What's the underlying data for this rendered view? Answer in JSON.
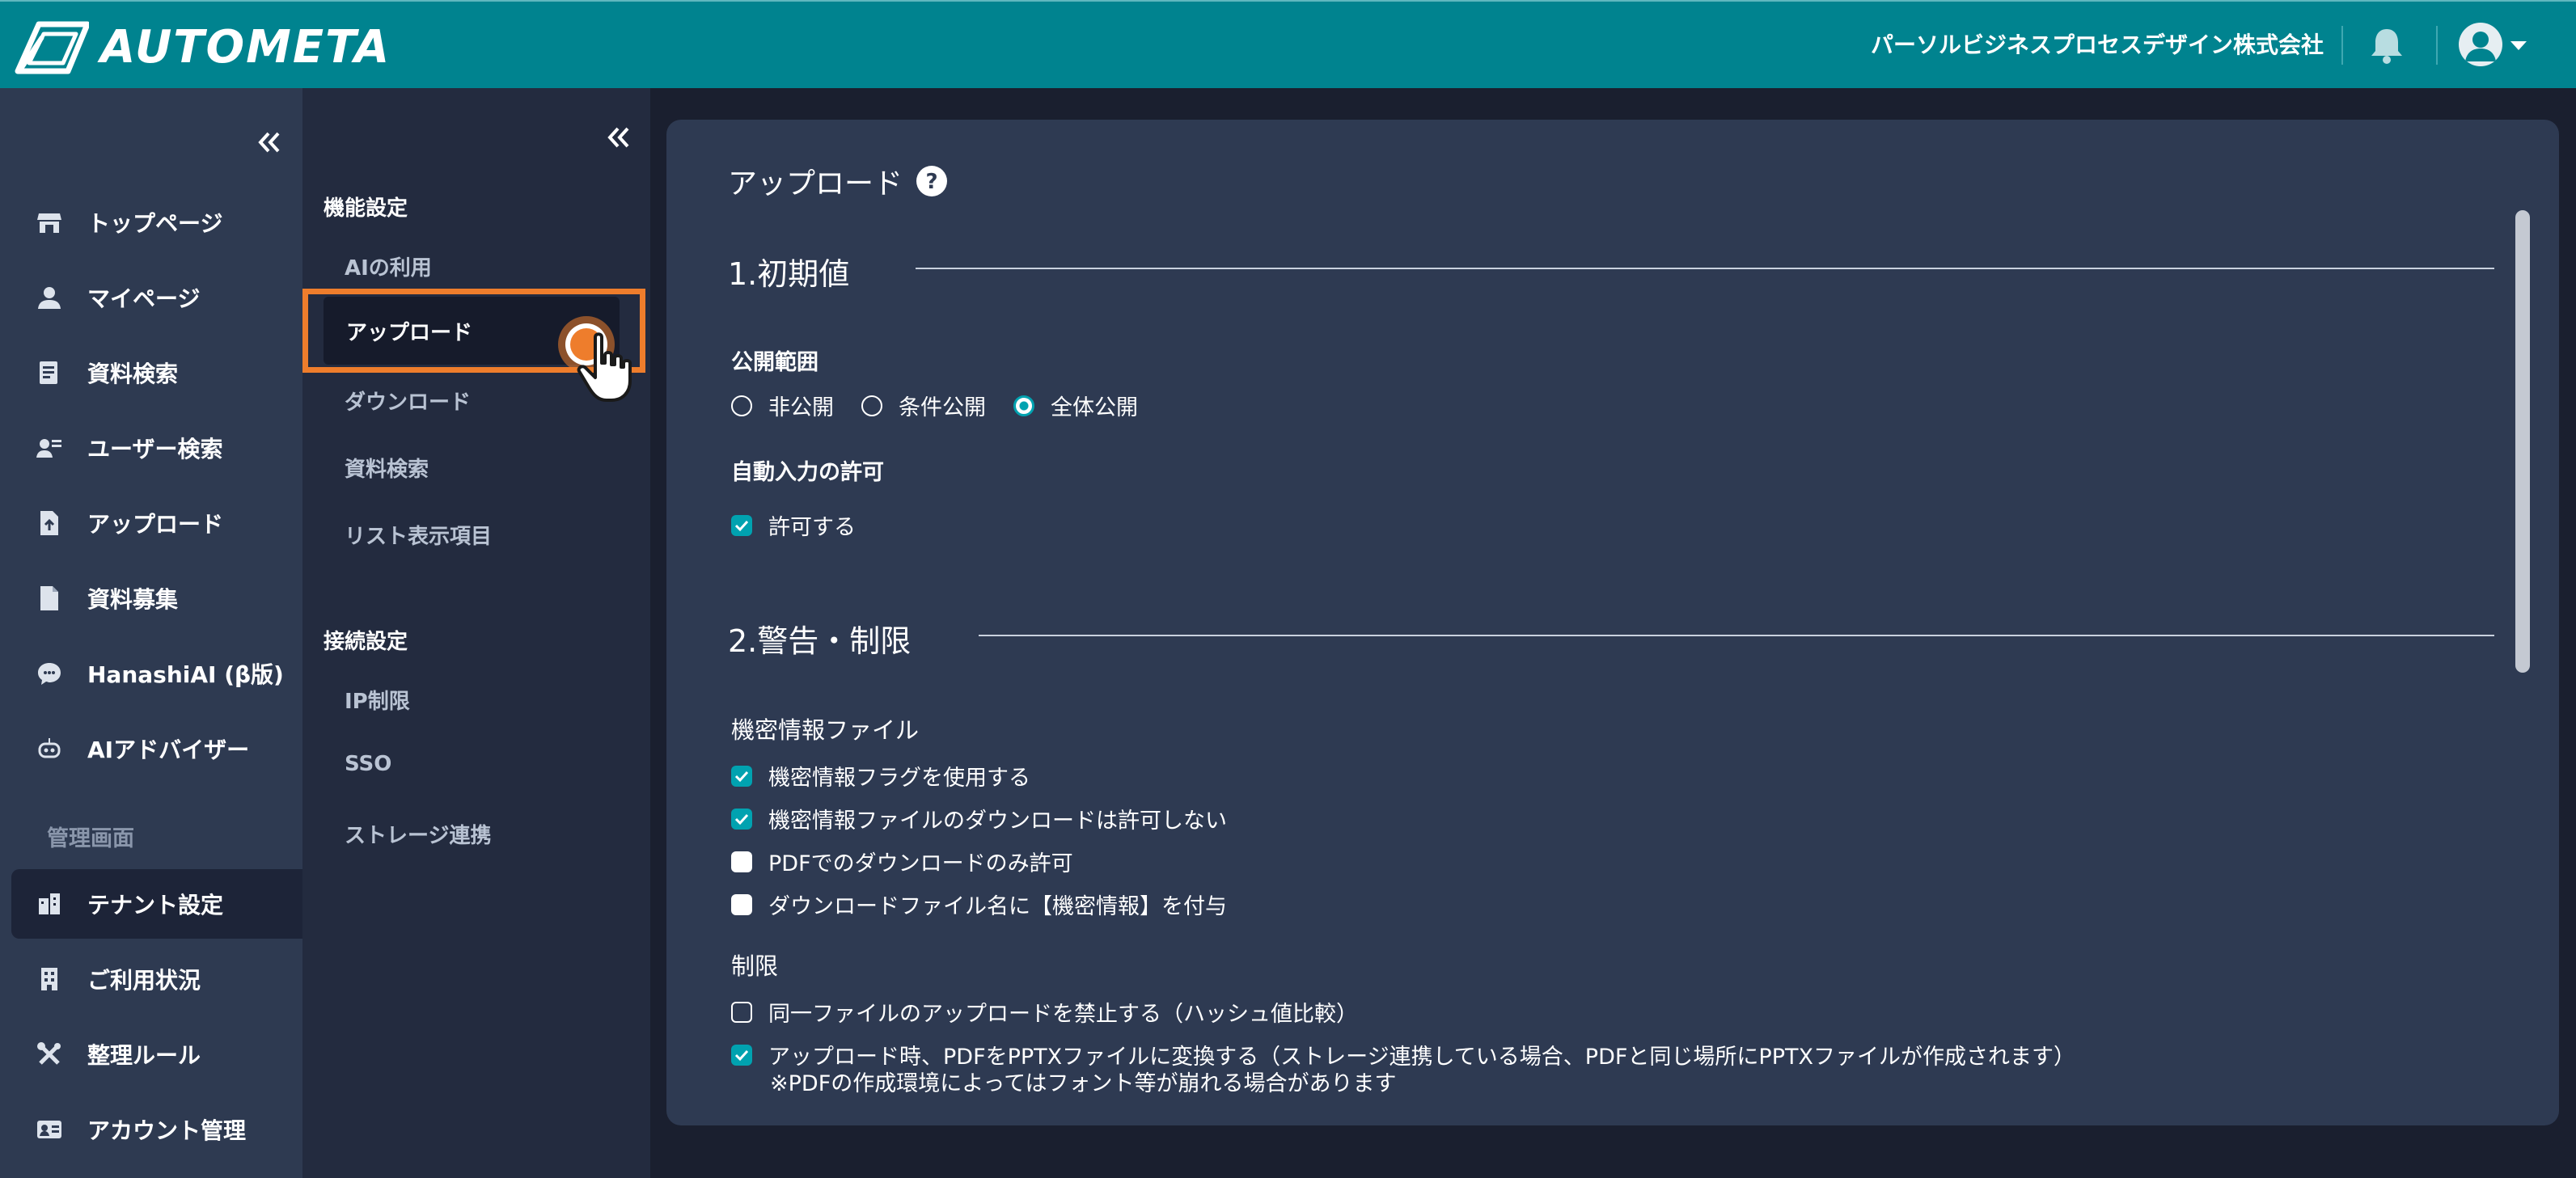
{
  "header": {
    "logo_text": "AUTOMETA",
    "company": "パーソルビジネスプロセスデザイン株式会社",
    "icons": [
      "bell-icon",
      "user-avatar-icon",
      "caret-down-icon"
    ]
  },
  "sidebar": {
    "items": [
      {
        "label": "トップページ",
        "icon": "store-icon"
      },
      {
        "label": "マイページ",
        "icon": "person-icon"
      },
      {
        "label": "資料検索",
        "icon": "document-search-icon"
      },
      {
        "label": "ユーザー検索",
        "icon": "user-search-icon"
      },
      {
        "label": "アップロード",
        "icon": "file-upload-icon"
      },
      {
        "label": "資料募集",
        "icon": "file-icon"
      },
      {
        "label": "HanashiAI (β版)",
        "icon": "chat-bubble-icon"
      },
      {
        "label": "AIアドバイザー",
        "icon": "robot-icon"
      }
    ],
    "section_label": "管理画面",
    "admin_items": [
      {
        "label": "テナント設定",
        "icon": "buildings-icon",
        "active": true
      },
      {
        "label": "ご利用状況",
        "icon": "building-icon"
      },
      {
        "label": "整理ルール",
        "icon": "tools-icon"
      },
      {
        "label": "アカウント管理",
        "icon": "id-card-icon"
      }
    ]
  },
  "subnav": {
    "heading1": "機能設定",
    "group1": [
      "AIの利用",
      "アップロード",
      "ダウンロード",
      "資料検索",
      "リスト表示項目"
    ],
    "active": "アップロード",
    "heading2": "接続設定",
    "group2": [
      "IP制限",
      "SSO",
      "ストレージ連携"
    ]
  },
  "main": {
    "title": "アップロード",
    "section1": {
      "title": "1.初期値",
      "scope_label": "公開範囲",
      "scope_options": [
        {
          "label": "非公開",
          "selected": false
        },
        {
          "label": "条件公開",
          "selected": false
        },
        {
          "label": "全体公開",
          "selected": true
        }
      ],
      "auto_label": "自動入力の許可",
      "auto_option": {
        "label": "許可する",
        "checked": true
      }
    },
    "section2": {
      "title": "2.警告・制限",
      "confidential_label": "機密情報ファイル",
      "confidential_options": [
        {
          "label": "機密情報フラグを使用する",
          "checked": true
        },
        {
          "label": "機密情報ファイルのダウンロードは許可しない",
          "checked": true
        },
        {
          "label": "PDFでのダウンロードのみ許可",
          "checked": false
        },
        {
          "label": "ダウンロードファイル名に【機密情報】を付与",
          "checked": false
        }
      ],
      "limit_label": "制限",
      "limit_options": [
        {
          "label": "同一ファイルのアップロードを禁止する（ハッシュ値比較）",
          "checked": false
        },
        {
          "label": "アップロード時、PDFをPPTXファイルに変換する（ストレージ連携している場合、PDFと同じ場所にPPTXファイルが作成されます）",
          "checked": true
        }
      ],
      "limit_note": "※PDFの作成環境によってはフォント等が崩れる場合があります"
    }
  },
  "colors": {
    "header": "#00838f",
    "accent": "#00a2b0",
    "highlight": "#ee7d2c"
  }
}
